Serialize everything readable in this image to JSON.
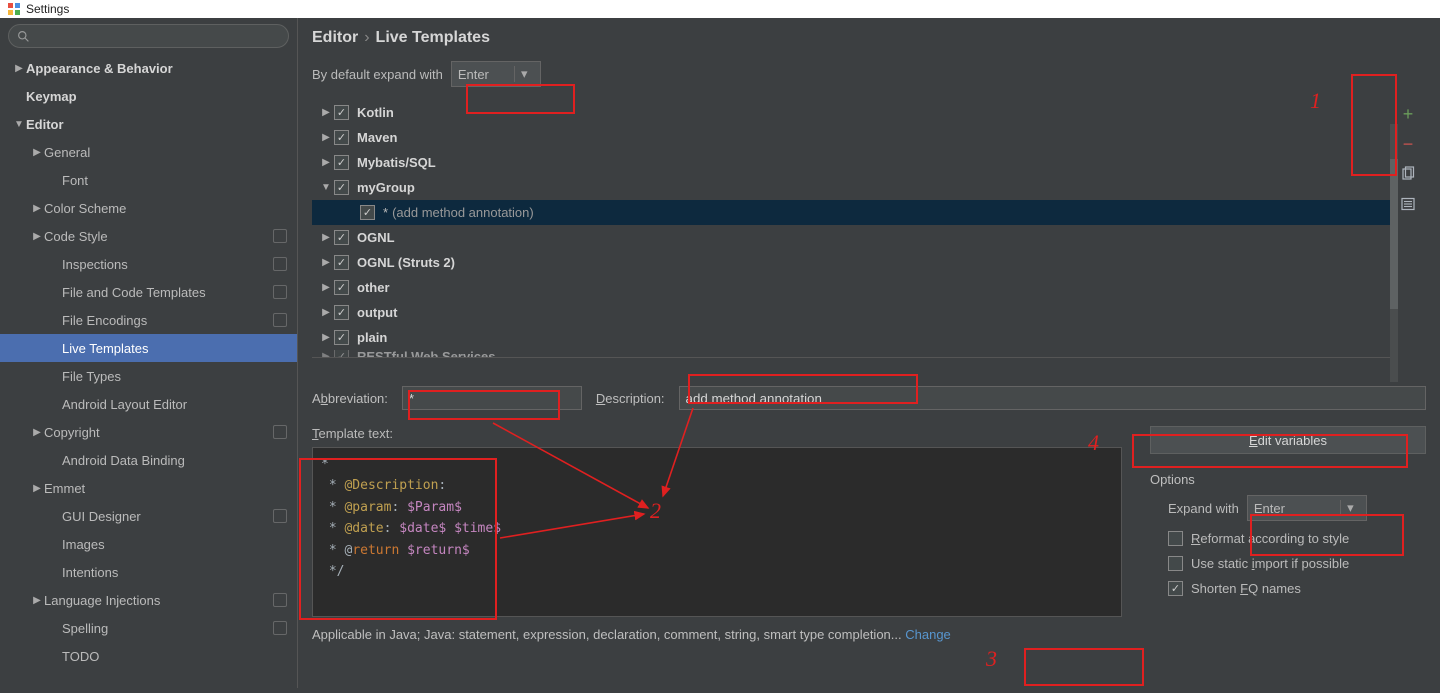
{
  "window": {
    "title": "Settings"
  },
  "breadcrumb": {
    "section": "Editor",
    "sep": "›",
    "page": "Live Templates"
  },
  "expand_default": {
    "label": "By default expand with",
    "value": "Enter"
  },
  "sidebar": {
    "items": [
      {
        "label": "Appearance & Behavior",
        "depth": 0,
        "arrow": "▶",
        "bold": true
      },
      {
        "label": "Keymap",
        "depth": 0,
        "arrow": "",
        "bold": true
      },
      {
        "label": "Editor",
        "depth": 0,
        "arrow": "▼",
        "bold": true
      },
      {
        "label": "General",
        "depth": 1,
        "arrow": "▶",
        "bold": false
      },
      {
        "label": "Font",
        "depth": 2,
        "arrow": "",
        "bold": false
      },
      {
        "label": "Color Scheme",
        "depth": 1,
        "arrow": "▶",
        "bold": false
      },
      {
        "label": "Code Style",
        "depth": 1,
        "arrow": "▶",
        "bold": false,
        "badge": true
      },
      {
        "label": "Inspections",
        "depth": 2,
        "arrow": "",
        "bold": false,
        "badge": true
      },
      {
        "label": "File and Code Templates",
        "depth": 2,
        "arrow": "",
        "bold": false,
        "badge": true
      },
      {
        "label": "File Encodings",
        "depth": 2,
        "arrow": "",
        "bold": false,
        "badge": true
      },
      {
        "label": "Live Templates",
        "depth": 2,
        "arrow": "",
        "bold": false,
        "selected": true
      },
      {
        "label": "File Types",
        "depth": 2,
        "arrow": "",
        "bold": false
      },
      {
        "label": "Android Layout Editor",
        "depth": 2,
        "arrow": "",
        "bold": false
      },
      {
        "label": "Copyright",
        "depth": 1,
        "arrow": "▶",
        "bold": false,
        "badge": true
      },
      {
        "label": "Android Data Binding",
        "depth": 2,
        "arrow": "",
        "bold": false
      },
      {
        "label": "Emmet",
        "depth": 1,
        "arrow": "▶",
        "bold": false
      },
      {
        "label": "GUI Designer",
        "depth": 2,
        "arrow": "",
        "bold": false,
        "badge": true
      },
      {
        "label": "Images",
        "depth": 2,
        "arrow": "",
        "bold": false
      },
      {
        "label": "Intentions",
        "depth": 2,
        "arrow": "",
        "bold": false
      },
      {
        "label": "Language Injections",
        "depth": 1,
        "arrow": "▶",
        "bold": false,
        "badge": true
      },
      {
        "label": "Spelling",
        "depth": 2,
        "arrow": "",
        "bold": false,
        "badge": true
      },
      {
        "label": "TODO",
        "depth": 2,
        "arrow": "",
        "bold": false
      }
    ]
  },
  "groups": [
    {
      "label": "Kotlin",
      "arrow": "▶",
      "checked": true
    },
    {
      "label": "Maven",
      "arrow": "▶",
      "checked": true
    },
    {
      "label": "Mybatis/SQL",
      "arrow": "▶",
      "checked": true
    },
    {
      "label": "myGroup",
      "arrow": "▼",
      "checked": true
    },
    {
      "label": "*",
      "extra": "(add method annotation)",
      "arrow": "",
      "checked": true,
      "item": true,
      "selected": true
    },
    {
      "label": "OGNL",
      "arrow": "▶",
      "checked": true
    },
    {
      "label": "OGNL (Struts 2)",
      "arrow": "▶",
      "checked": true
    },
    {
      "label": "other",
      "arrow": "▶",
      "checked": true
    },
    {
      "label": "output",
      "arrow": "▶",
      "checked": true
    },
    {
      "label": "plain",
      "arrow": "▶",
      "checked": true
    },
    {
      "label": "RESTful Web Services",
      "arrow": "▶",
      "checked": true,
      "cut": true
    }
  ],
  "form": {
    "abbr_label": "Abbreviation:",
    "abbr_value": "*",
    "desc_label": "Description:",
    "desc_value": "add method annotation",
    "template_label": "Template text:",
    "template_lines": [
      {
        "segs": [
          {
            "t": "*",
            "c": ""
          }
        ]
      },
      {
        "segs": [
          {
            "t": " * ",
            "c": ""
          },
          {
            "t": "@Description",
            "c": "at"
          },
          {
            "t": ":",
            "c": ""
          }
        ]
      },
      {
        "segs": [
          {
            "t": " * ",
            "c": ""
          },
          {
            "t": "@param",
            "c": "at"
          },
          {
            "t": ": ",
            "c": ""
          },
          {
            "t": "$Param$",
            "c": "var"
          }
        ]
      },
      {
        "segs": [
          {
            "t": " * ",
            "c": ""
          },
          {
            "t": "@date",
            "c": "at"
          },
          {
            "t": ": ",
            "c": ""
          },
          {
            "t": "$date$",
            "c": "var"
          },
          {
            "t": " ",
            "c": ""
          },
          {
            "t": "$time$",
            "c": "var"
          }
        ]
      },
      {
        "segs": [
          {
            "t": " * @",
            "c": ""
          },
          {
            "t": "return",
            "c": "kw"
          },
          {
            "t": " ",
            "c": ""
          },
          {
            "t": "$return$",
            "c": "var"
          }
        ]
      },
      {
        "segs": [
          {
            "t": " */",
            "c": ""
          }
        ]
      }
    ]
  },
  "right_panel": {
    "edit_vars": "Edit variables",
    "options_label": "Options",
    "expand_with_label": "Expand with",
    "expand_with_value": "Enter",
    "reformat_label": "Reformat according to style",
    "reformat_checked": false,
    "static_import_label": "Use static import if possible",
    "static_import_checked": false,
    "shorten_label": "Shorten FQ names",
    "shorten_checked": true
  },
  "applicable": {
    "text": "Applicable in Java; Java: statement, expression, declaration, comment, string, smart type completion...",
    "link": "Change"
  },
  "annotations": {
    "n1": "1",
    "n2": "2",
    "n3": "3",
    "n4": "4"
  }
}
